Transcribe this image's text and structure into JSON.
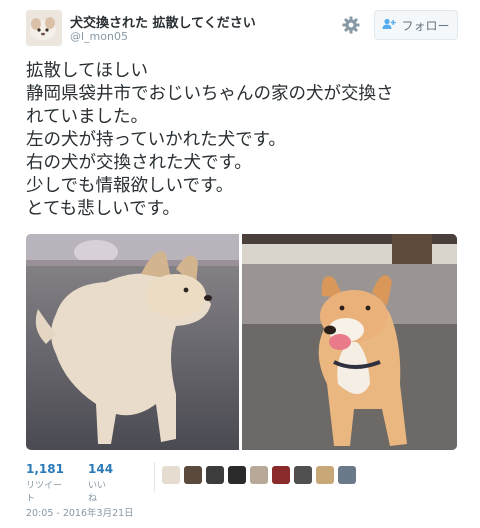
{
  "user": {
    "display_name": "犬交換された 拡散してください",
    "handle": "@l_mon05"
  },
  "follow_button": {
    "label": "フォロー"
  },
  "tweet": {
    "lines": [
      "拡散してほしい",
      "静岡県袋井市でおじいちゃんの家の犬が交換さ",
      "れていました。",
      "左の犬が持っていかれた犬です。",
      "右の犬が交換された犬です。",
      "少しでも情報欲しいです。",
      "とても悲しいです。"
    ]
  },
  "stats": {
    "retweets": {
      "count": "1,181",
      "label": "リツイート"
    },
    "likes": {
      "count": "144",
      "label": "いいね"
    }
  },
  "liker_avatars": [
    "avatar-1",
    "avatar-2",
    "avatar-3",
    "avatar-4",
    "avatar-5",
    "avatar-6",
    "avatar-7",
    "avatar-8",
    "avatar-9"
  ],
  "timestamp": "20:05 - 2016年3月21日",
  "colors": {
    "link_blue": "#2b7bb9",
    "muted": "#8899a6",
    "text": "#292f33",
    "border": "#e1e8ed"
  },
  "icons": {
    "settings": "gear-icon",
    "follow": "add-user-icon"
  }
}
